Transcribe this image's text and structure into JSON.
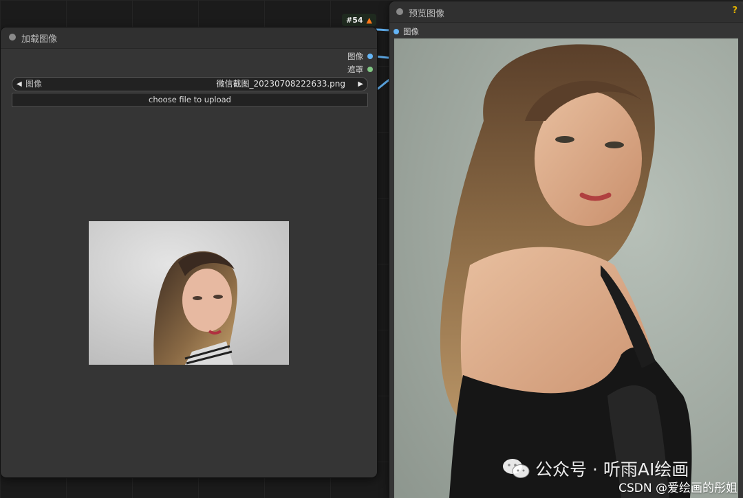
{
  "badge": {
    "text": "#54"
  },
  "load_node": {
    "title": "加载图像",
    "outputs": [
      {
        "label": "图像",
        "color": "#64b5f6"
      },
      {
        "label": "遮罩",
        "color": "#81c784"
      }
    ],
    "image_combo": {
      "label": "图像",
      "value": "微信截图_20230708222633.png"
    },
    "upload_button": "choose file to upload"
  },
  "preview_node": {
    "title": "预览图像",
    "help": "?",
    "input_label": "图像",
    "input_color": "#64b5f6"
  },
  "watermark": {
    "text": "公众号 · 听雨AI绘画",
    "csdn": "CSDN @爱绘画的彤姐"
  },
  "icons": [
    "fox-icon",
    "wechat-icon",
    "arrow-left-icon",
    "arrow-right-icon",
    "help-icon"
  ]
}
